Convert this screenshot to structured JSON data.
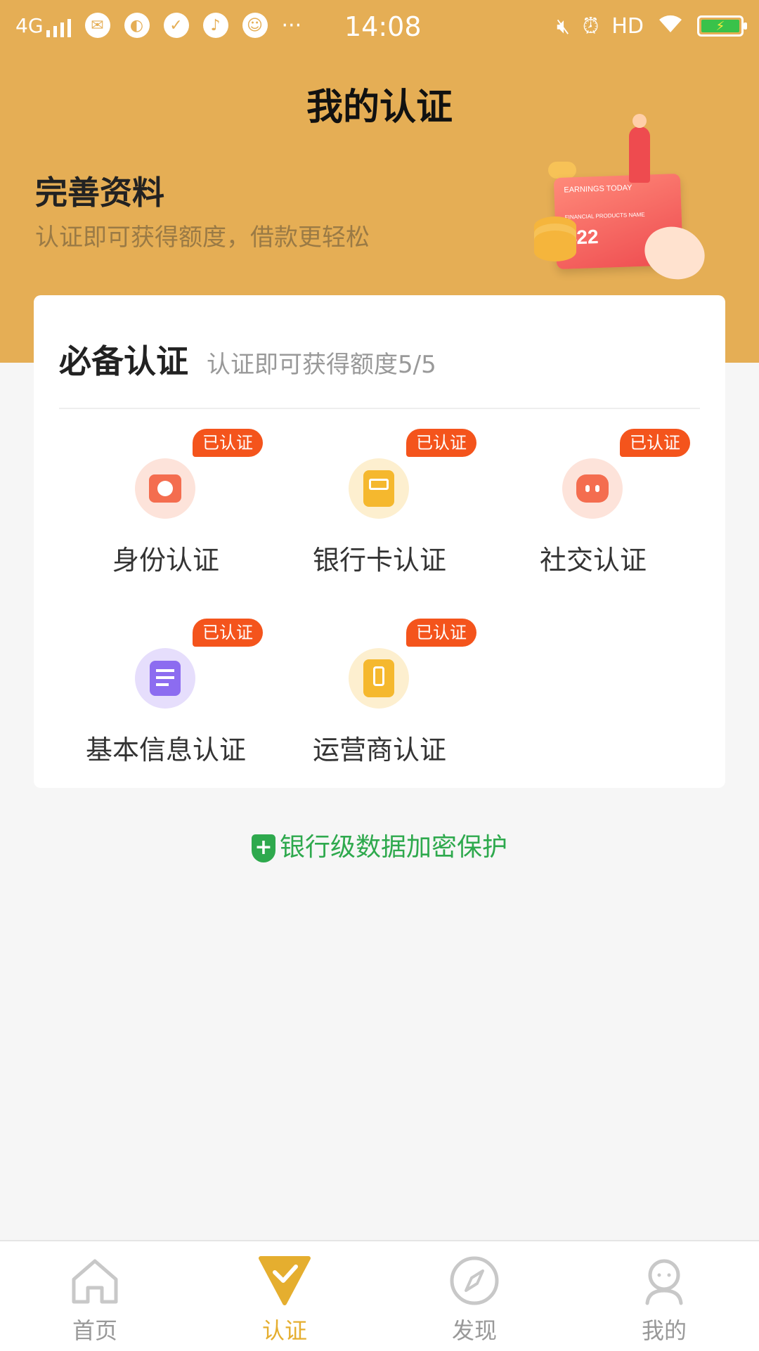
{
  "status_bar": {
    "network": "4G",
    "time": "14:08",
    "hd": "HD",
    "app_icons": [
      "wechat-icon",
      "saturn-icon",
      "check-circle-icon",
      "music-icon",
      "qq-icon"
    ],
    "more": "···"
  },
  "header": {
    "title": "我的认证"
  },
  "banner": {
    "title": "完善资料",
    "subtitle": "认证即可获得额度，借款更轻松",
    "illustration": {
      "card_line1": "EARNINGS TODAY",
      "card_line2": "FINANCIAL PRODUCTS NAME",
      "card_number": "422"
    }
  },
  "certification": {
    "title": "必备认证",
    "subtitle": "认证即可获得额度5/5",
    "items": [
      {
        "label": "身份认证",
        "badge": "已认证",
        "icon": "id-badge-icon",
        "color": "#f46d4f"
      },
      {
        "label": "银行卡认证",
        "badge": "已认证",
        "icon": "bank-card-icon",
        "color": "#f5b82e"
      },
      {
        "label": "社交认证",
        "badge": "已认证",
        "icon": "chat-bubble-icon",
        "color": "#f46d4f"
      },
      {
        "label": "基本信息认证",
        "badge": "已认证",
        "icon": "document-icon",
        "color": "#8c6cf0"
      },
      {
        "label": "运营商认证",
        "badge": "已认证",
        "icon": "phone-icon",
        "color": "#f5b82e"
      }
    ]
  },
  "protection": {
    "text": "银行级数据加密保护",
    "color": "#2ea94d"
  },
  "bottom_nav": {
    "items": [
      {
        "label": "首页",
        "icon": "home-icon",
        "active": false
      },
      {
        "label": "认证",
        "icon": "verify-check-icon",
        "active": true
      },
      {
        "label": "发现",
        "icon": "compass-icon",
        "active": false
      },
      {
        "label": "我的",
        "icon": "user-icon",
        "active": false
      }
    ],
    "active_color": "#e5ae2f"
  },
  "colors": {
    "header_bg": "#e5ae55",
    "badge": "#f4541c"
  }
}
